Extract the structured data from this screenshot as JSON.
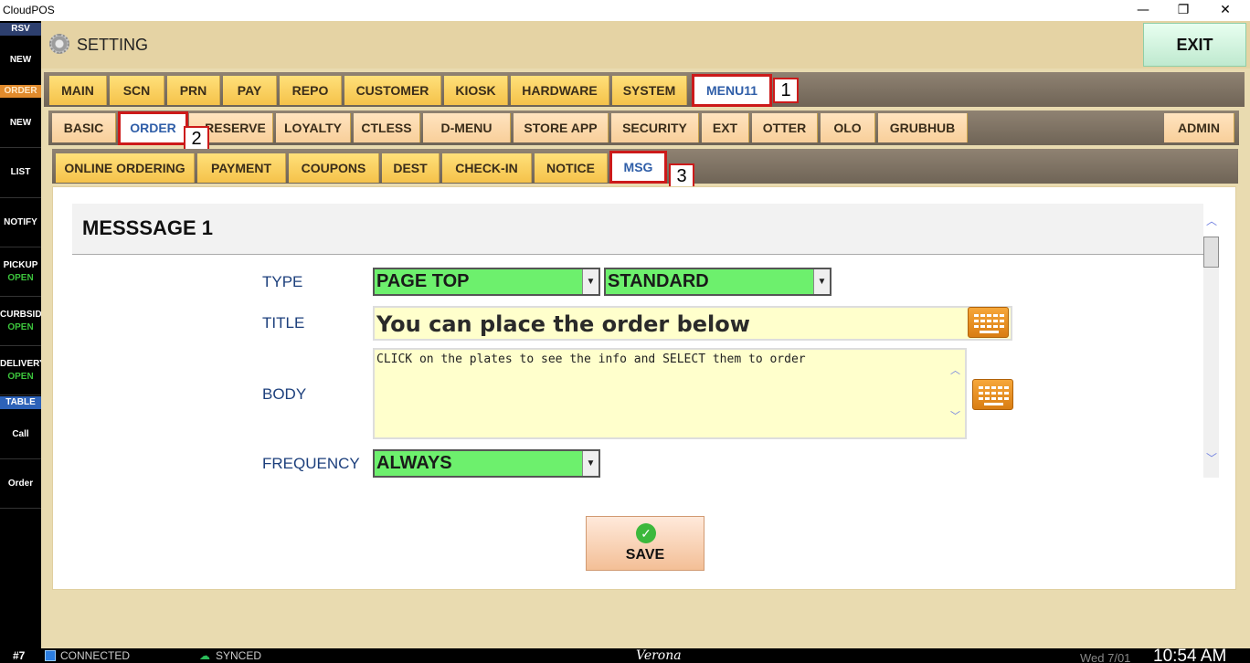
{
  "window": {
    "title": "CloudPOS",
    "controls": [
      "—",
      "❐",
      "✕"
    ]
  },
  "sidebar": {
    "rsv": "RSV",
    "order": "ORDER",
    "table": "TABLE",
    "items": [
      {
        "label": "NEW"
      },
      {
        "label": "NEW"
      },
      {
        "label": "LIST"
      },
      {
        "label": "NOTIFY"
      },
      {
        "label": "PICKUP",
        "sub": "OPEN"
      },
      {
        "label": "CURBSID",
        "sub": "OPEN"
      },
      {
        "label": "DELIVERY",
        "sub": "OPEN"
      },
      {
        "label": "Call"
      },
      {
        "label": "Order"
      }
    ]
  },
  "header": {
    "title": "SETTING",
    "exit": "EXIT"
  },
  "tabs1": [
    "MAIN",
    "SCN",
    "PRN",
    "PAY",
    "REPO",
    "CUSTOMER",
    "KIOSK",
    "HARDWARE",
    "SYSTEM",
    "MENU11"
  ],
  "tabs2": [
    "BASIC",
    "ORDER",
    "RESERVE",
    "LOYALTY",
    "CTLESS",
    "D-MENU",
    "STORE APP",
    "SECURITY",
    "EXT",
    "OTTER",
    "OLO",
    "GRUBHUB",
    "ADMIN"
  ],
  "tabs3": [
    "ONLINE ORDERING",
    "PAYMENT",
    "COUPONS",
    "DEST",
    "CHECK-IN",
    "NOTICE",
    "MSG"
  ],
  "callouts": [
    "1",
    "2",
    "3"
  ],
  "form": {
    "section_title": "MESSSAGE 1",
    "type_label": "TYPE",
    "type_value": "PAGE TOP",
    "style_value": "STANDARD",
    "title_label": "TITLE",
    "title_value": "You can place the order below",
    "body_label": "BODY",
    "body_value": "CLICK on the plates to see the info and SELECT them to order",
    "frequency_label": "FREQUENCY",
    "frequency_value": "ALWAYS",
    "save": "SAVE"
  },
  "status": {
    "station": "#7",
    "connection": "CONNECTED",
    "sync": "SYNCED",
    "store": "Verona",
    "date": "Wed 7/01",
    "time": "10:54 AM"
  },
  "colors": {
    "selected_outline": "#cc1a1a",
    "dropdown_green": "#6df06d",
    "tab_gold": "#f5c24a"
  }
}
